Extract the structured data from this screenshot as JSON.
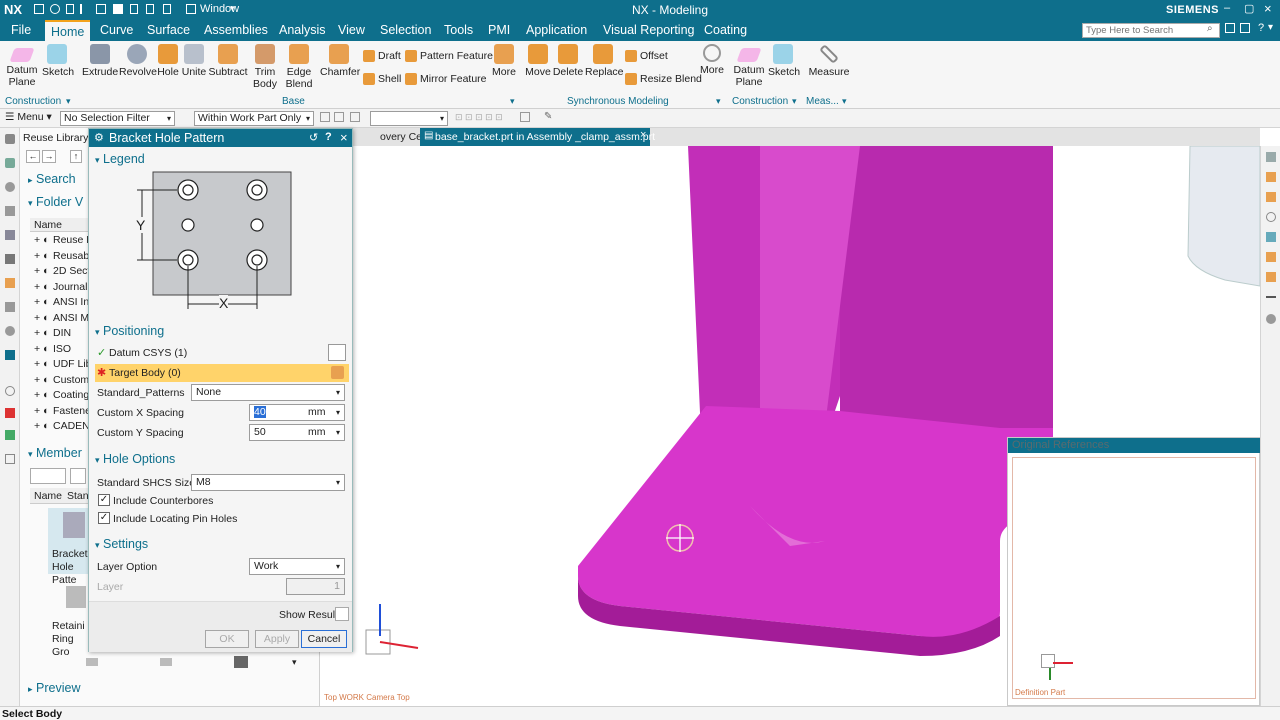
{
  "app": {
    "logo": "NX",
    "title": "NX - Modeling",
    "brand": "SIEMENS",
    "window_menu": "Window",
    "search_placeholder": "Type Here to Search"
  },
  "menu": [
    "File",
    "Home",
    "Curve",
    "Surface",
    "Assemblies",
    "Analysis",
    "View",
    "Selection",
    "Tools",
    "PMI",
    "Application",
    "Visual Reporting",
    "Coating"
  ],
  "ribbon": {
    "construction": {
      "datum_plane": "Datum Plane",
      "sketch": "Sketch",
      "label": "Construction"
    },
    "base": {
      "extrude": "Extrude",
      "revolve": "Revolve",
      "hole": "Hole",
      "unite": "Unite",
      "subtract": "Subtract",
      "trim_body": "Trim Body",
      "edge_blend": "Edge Blend",
      "chamfer": "Chamfer",
      "draft": "Draft",
      "shell": "Shell",
      "pattern_feature": "Pattern Feature",
      "mirror_feature": "Mirror Feature",
      "more": "More",
      "label": "Base"
    },
    "sync": {
      "move": "Move",
      "delete": "Delete",
      "replace": "Replace",
      "offset": "Offset",
      "resize_blend": "Resize Blend",
      "more": "More",
      "label": "Synchronous Modeling"
    },
    "construction2": {
      "datum_plane": "Datum Plane",
      "sketch": "Sketch",
      "label": "Construction"
    },
    "meas": {
      "measure": "Measure",
      "label": "Meas..."
    }
  },
  "toolbar": {
    "menu": "Menu",
    "selection_filter": "No Selection Filter",
    "scope": "Within Work Part Only"
  },
  "tabs": [
    "overy Center",
    "base_bracket.prt in Assembly _clamp_assm.prt"
  ],
  "reuse": {
    "title": "Reuse Library",
    "search": "Search",
    "folder_view": "Folder V",
    "name_col": "Name",
    "items": [
      "Reuse E",
      "Reusabl",
      "2D Sect",
      "Journal",
      "ANSI In",
      "ANSI M",
      "DIN",
      "ISO",
      "UDF Lib",
      "Custom",
      "Coating",
      "Fastene",
      "CADENA"
    ],
    "member": "Member",
    "member_cols": [
      "Name",
      "Stan"
    ],
    "member_items": [
      "Bracket Hole Patte",
      "Retaini Ring Gro"
    ],
    "preview": "Preview"
  },
  "dialog": {
    "title": "Bracket Hole Pattern",
    "legend": "Legend",
    "legend_y": "Y",
    "legend_x": "X",
    "positioning": "Positioning",
    "datum": "Datum CSYS (1)",
    "target": "Target Body (0)",
    "standard_patterns_label": "Standard_Patterns",
    "standard_patterns_value": "None",
    "cx_label": "Custom X Spacing",
    "cx_value": "40",
    "cx_unit": "mm",
    "cy_label": "Custom Y Spacing",
    "cy_value": "50",
    "cy_unit": "mm",
    "hole_options": "Hole Options",
    "shcs_label": "Standard SHCS Sizes",
    "shcs_value": "M8",
    "counterbores": "Include Counterbores",
    "pins": "Include Locating Pin Holes",
    "settings": "Settings",
    "layer_option_label": "Layer Option",
    "layer_option_value": "Work",
    "layer_label": "Layer",
    "layer_value": "1",
    "show_result": "Show Result",
    "ok": "OK",
    "apply": "Apply",
    "cancel": "Cancel"
  },
  "viewport": {
    "camera": "Top WORK Camera Top",
    "orig_ref": "Original References",
    "def_part": "Definition Part"
  },
  "status": "Select Body",
  "colors": {
    "teal": "#0e6f8c",
    "magenta": "#d21bc9",
    "orange": "#f3a21b"
  }
}
